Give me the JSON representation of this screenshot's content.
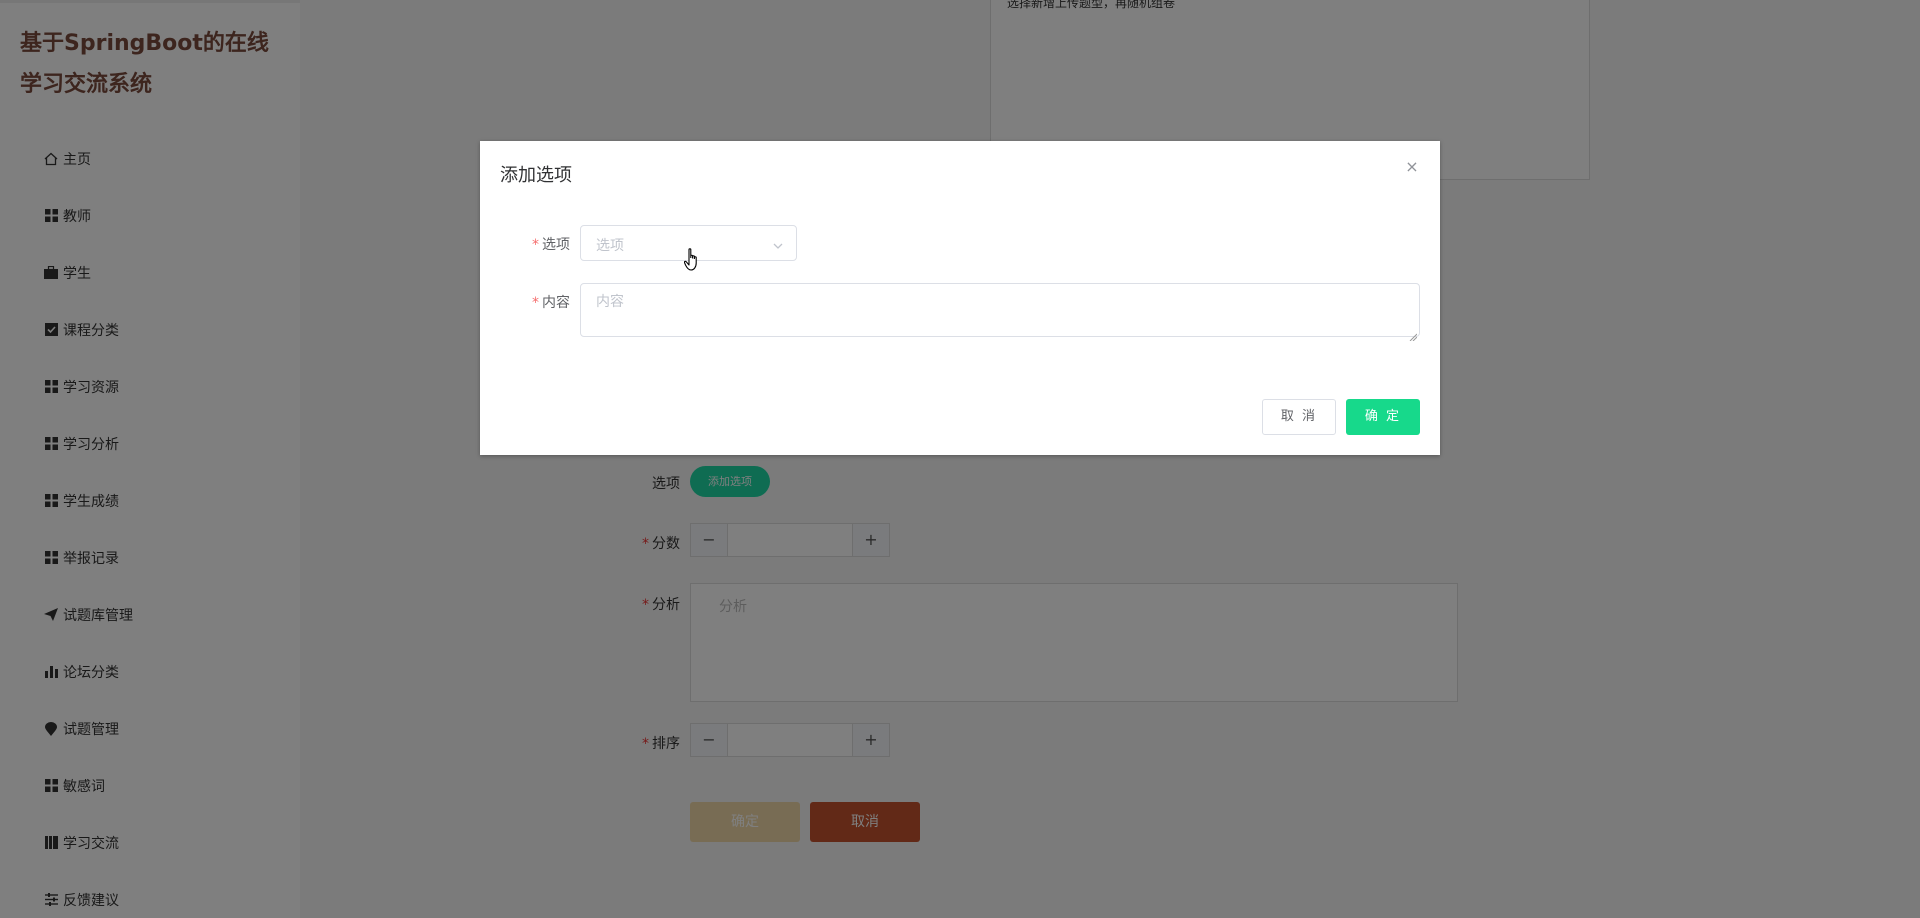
{
  "sidebar": {
    "brand": "基于SpringBoot的在线学习交流系统",
    "items": [
      {
        "label": "主页",
        "icon": "home-icon"
      },
      {
        "label": "教师",
        "icon": "grid-icon"
      },
      {
        "label": "学生",
        "icon": "briefcase-icon"
      },
      {
        "label": "课程分类",
        "icon": "check-square-icon"
      },
      {
        "label": "学习资源",
        "icon": "grid-icon"
      },
      {
        "label": "学习分析",
        "icon": "grid-icon"
      },
      {
        "label": "学生成绩",
        "icon": "grid-icon"
      },
      {
        "label": "举报记录",
        "icon": "grid-icon"
      },
      {
        "label": "试题库管理",
        "icon": "paper-plane-icon"
      },
      {
        "label": "论坛分类",
        "icon": "bar-chart-icon"
      },
      {
        "label": "试题管理",
        "icon": "location-pin-icon"
      },
      {
        "label": "敏感词",
        "icon": "grid-icon"
      },
      {
        "label": "学习交流",
        "icon": "book-icon"
      },
      {
        "label": "反馈建议",
        "icon": "sliders-icon"
      }
    ]
  },
  "form": {
    "top_text": "选择新增上传题型，再随机组卷",
    "options_label": "选项",
    "add_option_button": "添加选项",
    "score_label": "分数",
    "analysis_label": "分析",
    "analysis_placeholder": "分析",
    "sort_label": "排序",
    "stepper_minus": "−",
    "stepper_plus": "+",
    "confirm_button": "确定",
    "cancel_button": "取消"
  },
  "dialog": {
    "title": "添加选项",
    "close": "×",
    "option_label": "选项",
    "option_placeholder": "选项",
    "content_label": "内容",
    "content_placeholder": "内容",
    "cancel_button": "取 消",
    "ok_button": "确 定"
  },
  "colors": {
    "brand_text": "#7a4a3c",
    "accent_green": "#17d98b",
    "confirm_bg": "#f0d9a8",
    "cancel_bg": "#c4532f",
    "required": "#f56c6c"
  }
}
